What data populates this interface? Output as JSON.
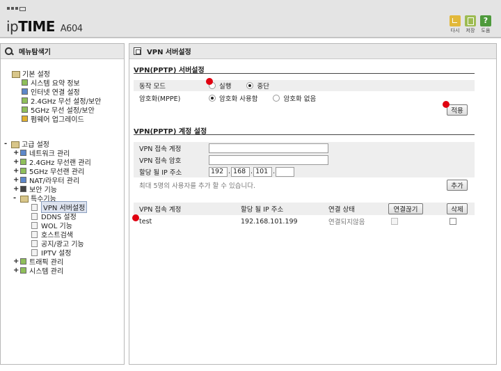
{
  "header": {
    "brand_light": "ip",
    "brand_bold": "TIME",
    "model": "A604",
    "icons": [
      {
        "name": "refresh-icon",
        "label": "다시"
      },
      {
        "name": "save-icon",
        "label": "저장"
      },
      {
        "name": "help-icon",
        "label": "도움",
        "glyph": "?"
      }
    ]
  },
  "sidebar": {
    "title": "메뉴탐색기",
    "basic": {
      "label": "기본 설정",
      "items": [
        "시스템 요약 정보",
        "인터넷 연결 설정",
        "2.4GHz 무선 설정/보안",
        "5GHz 무선 설정/보안",
        "펌웨어 업그레이드"
      ]
    },
    "advanced": {
      "label": "고급 설정",
      "items": [
        "네트워크 관리",
        "2.4GHz 무선랜 관리",
        "5GHz 무선랜 관리",
        "NAT/라우터 관리",
        "보안 기능",
        "특수기능"
      ],
      "special_items": [
        "VPN 서버설정",
        "DDNS 설정",
        "WOL 기능",
        "호스트검색",
        "공지/광고 기능",
        "IPTV 설정"
      ],
      "after_items": [
        "트래픽 관리",
        "시스템 관리"
      ],
      "expand_plus": "+",
      "expand_minus": "-"
    }
  },
  "main": {
    "title": "VPN 서버설정",
    "server_section": {
      "title": "VPN(PPTP) 서버설정",
      "mode_label": "동작 모드",
      "mode_run": "실행",
      "mode_stop": "중단",
      "mode_selected": "중단",
      "enc_label": "암호화(MPPE)",
      "enc_use": "암호화 사용함",
      "enc_none": "암호화 없음",
      "enc_selected": "암호화 사용함",
      "apply_button": "적용"
    },
    "account_section": {
      "title": "VPN(PPTP) 계정 설정",
      "account_label": "VPN 접속 계정",
      "account_value": "",
      "password_label": "VPN 접속 암호",
      "password_value": "",
      "ip_label": "할당 될 IP 주소",
      "ip": [
        "192",
        "168",
        "101",
        ""
      ],
      "note": "최대 5명의 사용자를 추가 할 수 있습니다.",
      "add_button": "추가"
    },
    "table": {
      "headers": [
        "VPN 접속 계정",
        "할당 될 IP 주소",
        "연결 상태"
      ],
      "disconnect_button": "연결끊기",
      "delete_button": "삭제",
      "rows": [
        {
          "account": "test",
          "ip": "192.168.101.199",
          "status": "연결되지않음"
        }
      ]
    }
  },
  "colors": {
    "marker": "#e00010",
    "header_bg": "#e4e4e4"
  }
}
